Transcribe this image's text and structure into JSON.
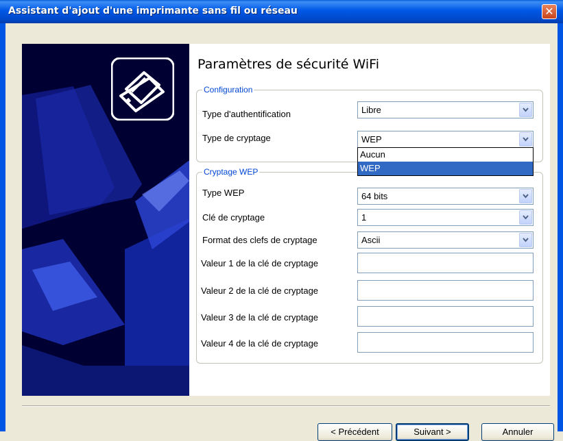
{
  "window": {
    "title": "Assistant d'ajout d'une imprimante sans fil ou réseau",
    "close_label": "✕"
  },
  "page": {
    "heading": "Paramètres de sécurité WiFi"
  },
  "configuration": {
    "legend": "Configuration",
    "auth_label": "Type d'authentification",
    "auth_value": "Libre",
    "encryption_label": "Type de cryptage",
    "encryption_value": "WEP",
    "encryption_options": [
      "Aucun",
      "WEP"
    ],
    "encryption_selected_index": 1
  },
  "wep": {
    "legend": "Cryptage WEP",
    "type_label": "Type WEP",
    "type_value": "64 bits",
    "key_label": "Clé de cryptage",
    "key_value": "1",
    "format_label": "Format des clefs de cryptage",
    "format_value": "Ascii",
    "key_values": [
      {
        "label": "Valeur 1 de la clé de cryptage",
        "value": ""
      },
      {
        "label": "Valeur 2 de la clé de cryptage",
        "value": ""
      },
      {
        "label": "Valeur 3 de la clé de cryptage",
        "value": ""
      },
      {
        "label": "Valeur 4 de la clé de cryptage",
        "value": ""
      }
    ]
  },
  "buttons": {
    "back": "< Précédent",
    "next": "Suivant >",
    "cancel": "Annuler"
  },
  "colors": {
    "title_bar": "#0055e5",
    "group_legend": "#0046d5",
    "selection": "#316ac5",
    "art_background": "#000033"
  },
  "icons": {
    "printer": "printer-icon",
    "dropdown": "chevron-down-icon",
    "close": "close-icon"
  }
}
